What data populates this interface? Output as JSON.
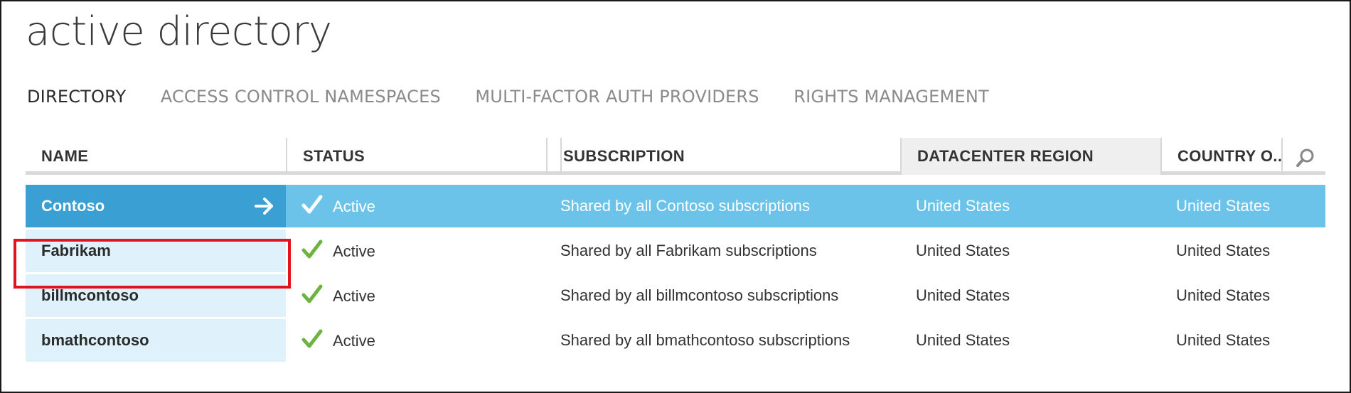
{
  "page": {
    "title": "active directory"
  },
  "tabs": [
    {
      "label": "DIRECTORY",
      "active": true
    },
    {
      "label": "ACCESS CONTROL NAMESPACES",
      "active": false
    },
    {
      "label": "MULTI-FACTOR AUTH PROVIDERS",
      "active": false
    },
    {
      "label": "RIGHTS MANAGEMENT",
      "active": false
    }
  ],
  "table": {
    "columns": [
      "NAME",
      "STATUS",
      "SUBSCRIPTION",
      "DATACENTER REGION",
      "COUNTRY O..."
    ],
    "search_icon": "search-icon",
    "rows": [
      {
        "name": "Contoso",
        "status": "Active",
        "subscription": "Shared by all Contoso subscriptions",
        "datacenter": "United States",
        "country": "United States",
        "selected": true
      },
      {
        "name": "Fabrikam",
        "status": "Active",
        "subscription": "Shared by all Fabrikam subscriptions",
        "datacenter": "United States",
        "country": "United States",
        "selected": false
      },
      {
        "name": "billmcontoso",
        "status": "Active",
        "subscription": "Shared by all billmcontoso subscriptions",
        "datacenter": "United States",
        "country": "United States",
        "selected": false
      },
      {
        "name": "bmathcontoso",
        "status": "Active",
        "subscription": "Shared by all bmathcontoso subscriptions",
        "datacenter": "United States",
        "country": "United States",
        "selected": false
      }
    ]
  },
  "colors": {
    "selected_row": "#6cc3ea",
    "selected_name_cell": "#3a9fd2",
    "name_cell": "#dff1fb",
    "check_green": "#6cb33f",
    "highlight_red": "#e0141e"
  }
}
